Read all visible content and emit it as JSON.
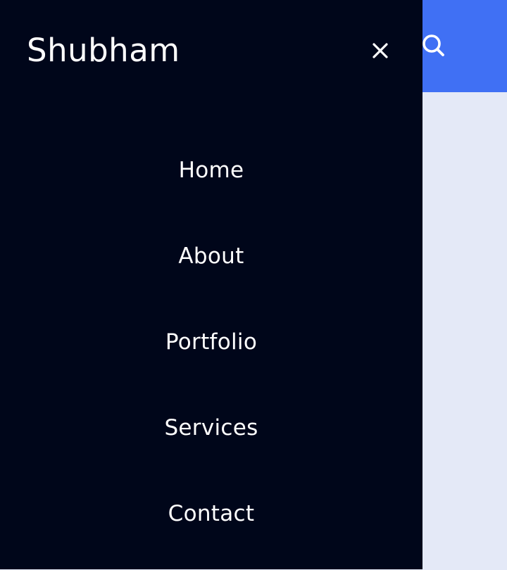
{
  "drawer": {
    "brand": "Shubham",
    "close_icon": "close-icon",
    "nav_items": [
      {
        "label": "Home"
      },
      {
        "label": "About"
      },
      {
        "label": "Portfolio"
      },
      {
        "label": "Services"
      },
      {
        "label": "Contact"
      }
    ]
  },
  "header": {
    "search_icon": "search-icon"
  },
  "colors": {
    "drawer_bg": "#00061a",
    "header_accent": "#4070f4",
    "page_bg": "#e4e9f7",
    "text": "#ffffff"
  }
}
